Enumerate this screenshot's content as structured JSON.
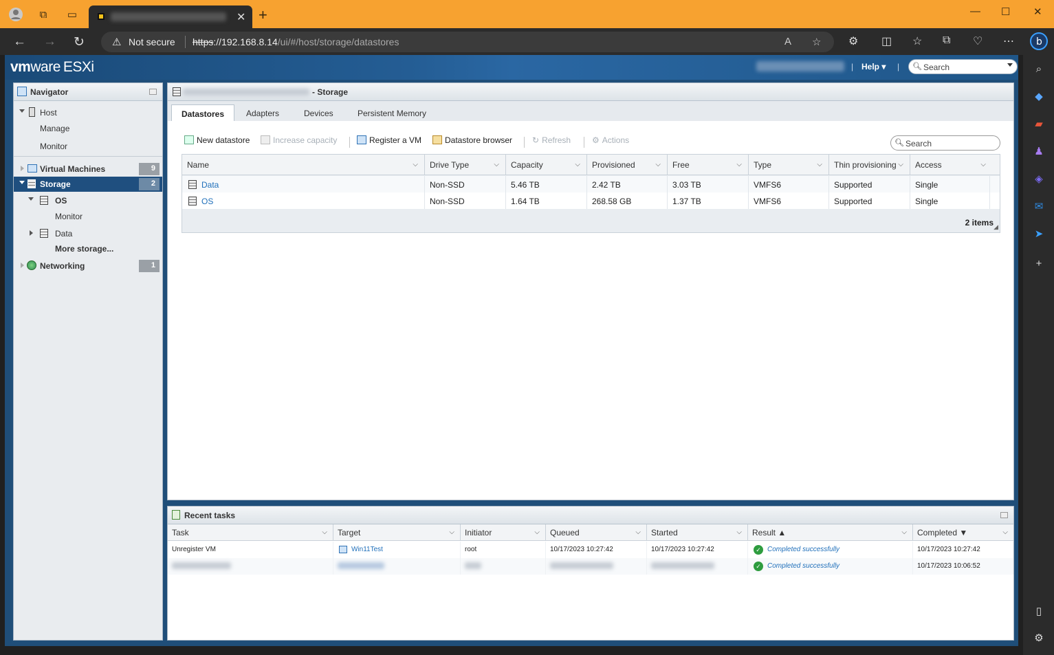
{
  "browser": {
    "url_scheme": "https",
    "url_host": "://192.168.8.14",
    "url_path": "/ui/#/host/storage/datastores",
    "security_label": "Not secure"
  },
  "header": {
    "logo_vm": "vm",
    "logo_ware": "ware",
    "product": "ESXi",
    "help_label": "Help",
    "search_placeholder": "Search"
  },
  "navigator": {
    "title": "Navigator",
    "host": {
      "label": "Host",
      "children": [
        "Manage",
        "Monitor"
      ]
    },
    "virtual_machines": {
      "label": "Virtual Machines",
      "count": "9"
    },
    "storage": {
      "label": "Storage",
      "count": "2",
      "children": [
        {
          "label": "OS",
          "sub": "Monitor"
        },
        {
          "label": "Data"
        }
      ],
      "more": "More storage..."
    },
    "networking": {
      "label": "Networking",
      "count": "1"
    }
  },
  "main": {
    "title_suffix": "- Storage",
    "tabs": [
      "Datastores",
      "Adapters",
      "Devices",
      "Persistent Memory"
    ],
    "toolbar": {
      "new_datastore": "New datastore",
      "increase_capacity": "Increase capacity",
      "register_vm": "Register a VM",
      "datastore_browser": "Datastore browser",
      "refresh": "Refresh",
      "actions": "Actions"
    },
    "search_placeholder": "Search",
    "columns": [
      "Name",
      "Drive Type",
      "Capacity",
      "Provisioned",
      "Free",
      "Type",
      "Thin provisioning",
      "Access"
    ],
    "rows": [
      [
        "Data",
        "Non-SSD",
        "5.46 TB",
        "2.42 TB",
        "3.03 TB",
        "VMFS6",
        "Supported",
        "Single"
      ],
      [
        "OS",
        "Non-SSD",
        "1.64 TB",
        "268.58 GB",
        "1.37 TB",
        "VMFS6",
        "Supported",
        "Single"
      ]
    ],
    "footer": "2 items"
  },
  "tasks": {
    "title": "Recent tasks",
    "columns": [
      "Task",
      "Target",
      "Initiator",
      "Queued",
      "Started",
      "Result ▲",
      "Completed ▼"
    ],
    "rows": [
      {
        "task": "Unregister VM",
        "target": "Win11Test",
        "initiator": "root",
        "queued": "10/17/2023 10:27:42",
        "started": "10/17/2023 10:27:42",
        "result": "Completed successfully",
        "completed": "10/17/2023 10:27:42"
      },
      {
        "result": "Completed successfully",
        "completed": "10/17/2023 10:06:52"
      }
    ]
  }
}
